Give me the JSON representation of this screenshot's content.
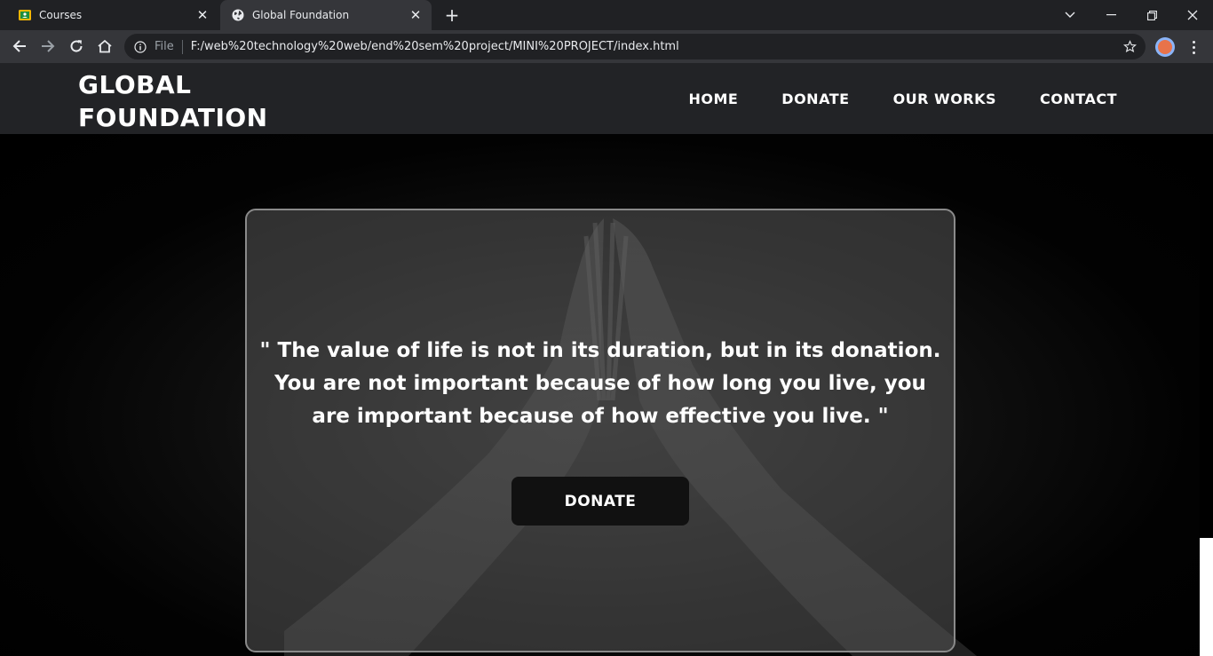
{
  "browser": {
    "tabs": [
      {
        "title": "Courses",
        "icon": "classroom-icon",
        "active": false
      },
      {
        "title": "Global Foundation",
        "icon": "globe-icon",
        "active": true
      }
    ],
    "address": {
      "scheme_label": "File",
      "url": "F:/web%20technology%20web/end%20sem%20project/MINI%20PROJECT/index.html"
    }
  },
  "site": {
    "brand": "GLOBAL FOUNDATION",
    "nav": {
      "home": "HOME",
      "donate": "DONATE",
      "works": "OUR WORKS",
      "contact": "CONTACT"
    },
    "hero": {
      "quote": "\" The value of life is not in its duration, but in its donation. You are not important because of how long you live, you are important because of how effective you live. \"",
      "button": "DONATE"
    }
  },
  "colors": {
    "header_bg": "#222326",
    "card_bg": "rgba(85,85,85,0.55)",
    "button_bg": "#111111",
    "chrome_dark": "#202124",
    "chrome_mid": "#35363a"
  }
}
